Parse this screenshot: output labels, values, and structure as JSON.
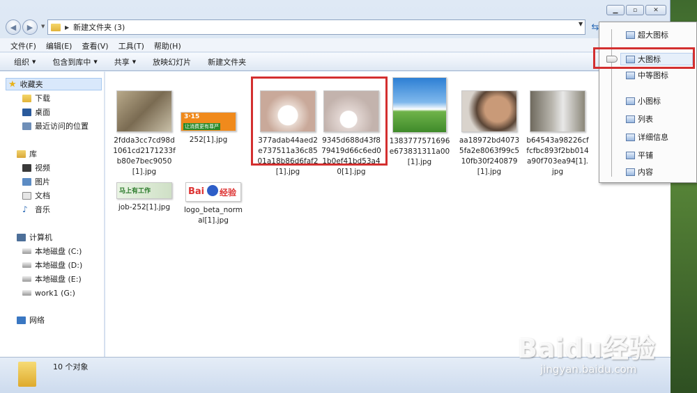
{
  "address": {
    "path": "新建文件夹 (3)"
  },
  "menus": [
    "文件(F)",
    "编辑(E)",
    "查看(V)",
    "工具(T)",
    "帮助(H)"
  ],
  "commands": [
    {
      "label": "组织",
      "dropdown": true
    },
    {
      "label": "包含到库中",
      "dropdown": true
    },
    {
      "label": "共享",
      "dropdown": true
    },
    {
      "label": "放映幻灯片",
      "dropdown": false
    },
    {
      "label": "新建文件夹",
      "dropdown": false
    }
  ],
  "nav": {
    "favorites": "收藏夹",
    "downloads": "下载",
    "desktop": "桌面",
    "recent": "最近访问的位置",
    "libraries": "库",
    "videos": "视频",
    "pictures": "图片",
    "documents": "文档",
    "music": "音乐",
    "computer": "计算机",
    "drive_c": "本地磁盘 (C:)",
    "drive_d": "本地磁盘 (D:)",
    "drive_e": "本地磁盘 (E:)",
    "drive_g": "work1 (G:)",
    "network": "网络"
  },
  "files": [
    {
      "name": "2fdda3cc7cd98d1061cd2171233fb80e7bec9050[1].jpg",
      "thumb_color": "#9a8c6e"
    },
    {
      "name": "252[1].jpg",
      "thumb_color": "#f08a1c"
    },
    {
      "name": "377adab44aed2e737511a36c8501a18b86d6faf2[1].jpg",
      "thumb_color": "#d8c6bc"
    },
    {
      "name": "9345d688d43f879419d66c6ed01b0ef41bd53a40[1].jpg",
      "thumb_color": "#d6cbc7"
    },
    {
      "name": "1383777571696e673831311a00[1].jpg",
      "thumb_color": "#3d8fd8"
    },
    {
      "name": "aa18972bd40735fa2e8063f99c510fb30f240879[1].jpg",
      "thumb_color": "#6a5446"
    },
    {
      "name": "b64543a98226cffcfbc893f2bb014a90f703ea94[1].jpg",
      "thumb_color": "#8f8a80"
    },
    {
      "name": "job-252[1].jpg",
      "thumb_color": "#cfe0c6"
    },
    {
      "name": "logo_beta_normal[1].jpg",
      "thumb_color": "#ffffff"
    }
  ],
  "status": {
    "count": "10 个对象"
  },
  "view_menu": [
    "超大图标",
    "大图标",
    "中等图标",
    "小图标",
    "列表",
    "详细信息",
    "平铺",
    "内容"
  ],
  "thumb_texts": {
    "t252_top": "3·15",
    "t252_bottom": "让消费更有尊严",
    "job": "马上有工作",
    "baidu": "Bai",
    "baidu2": "经验"
  },
  "watermark": {
    "brand": "Baidu经验",
    "url": "jingyan.baidu.com"
  },
  "colors": {
    "highlight": "#d32f2f",
    "accent": "#2d6bb5"
  }
}
